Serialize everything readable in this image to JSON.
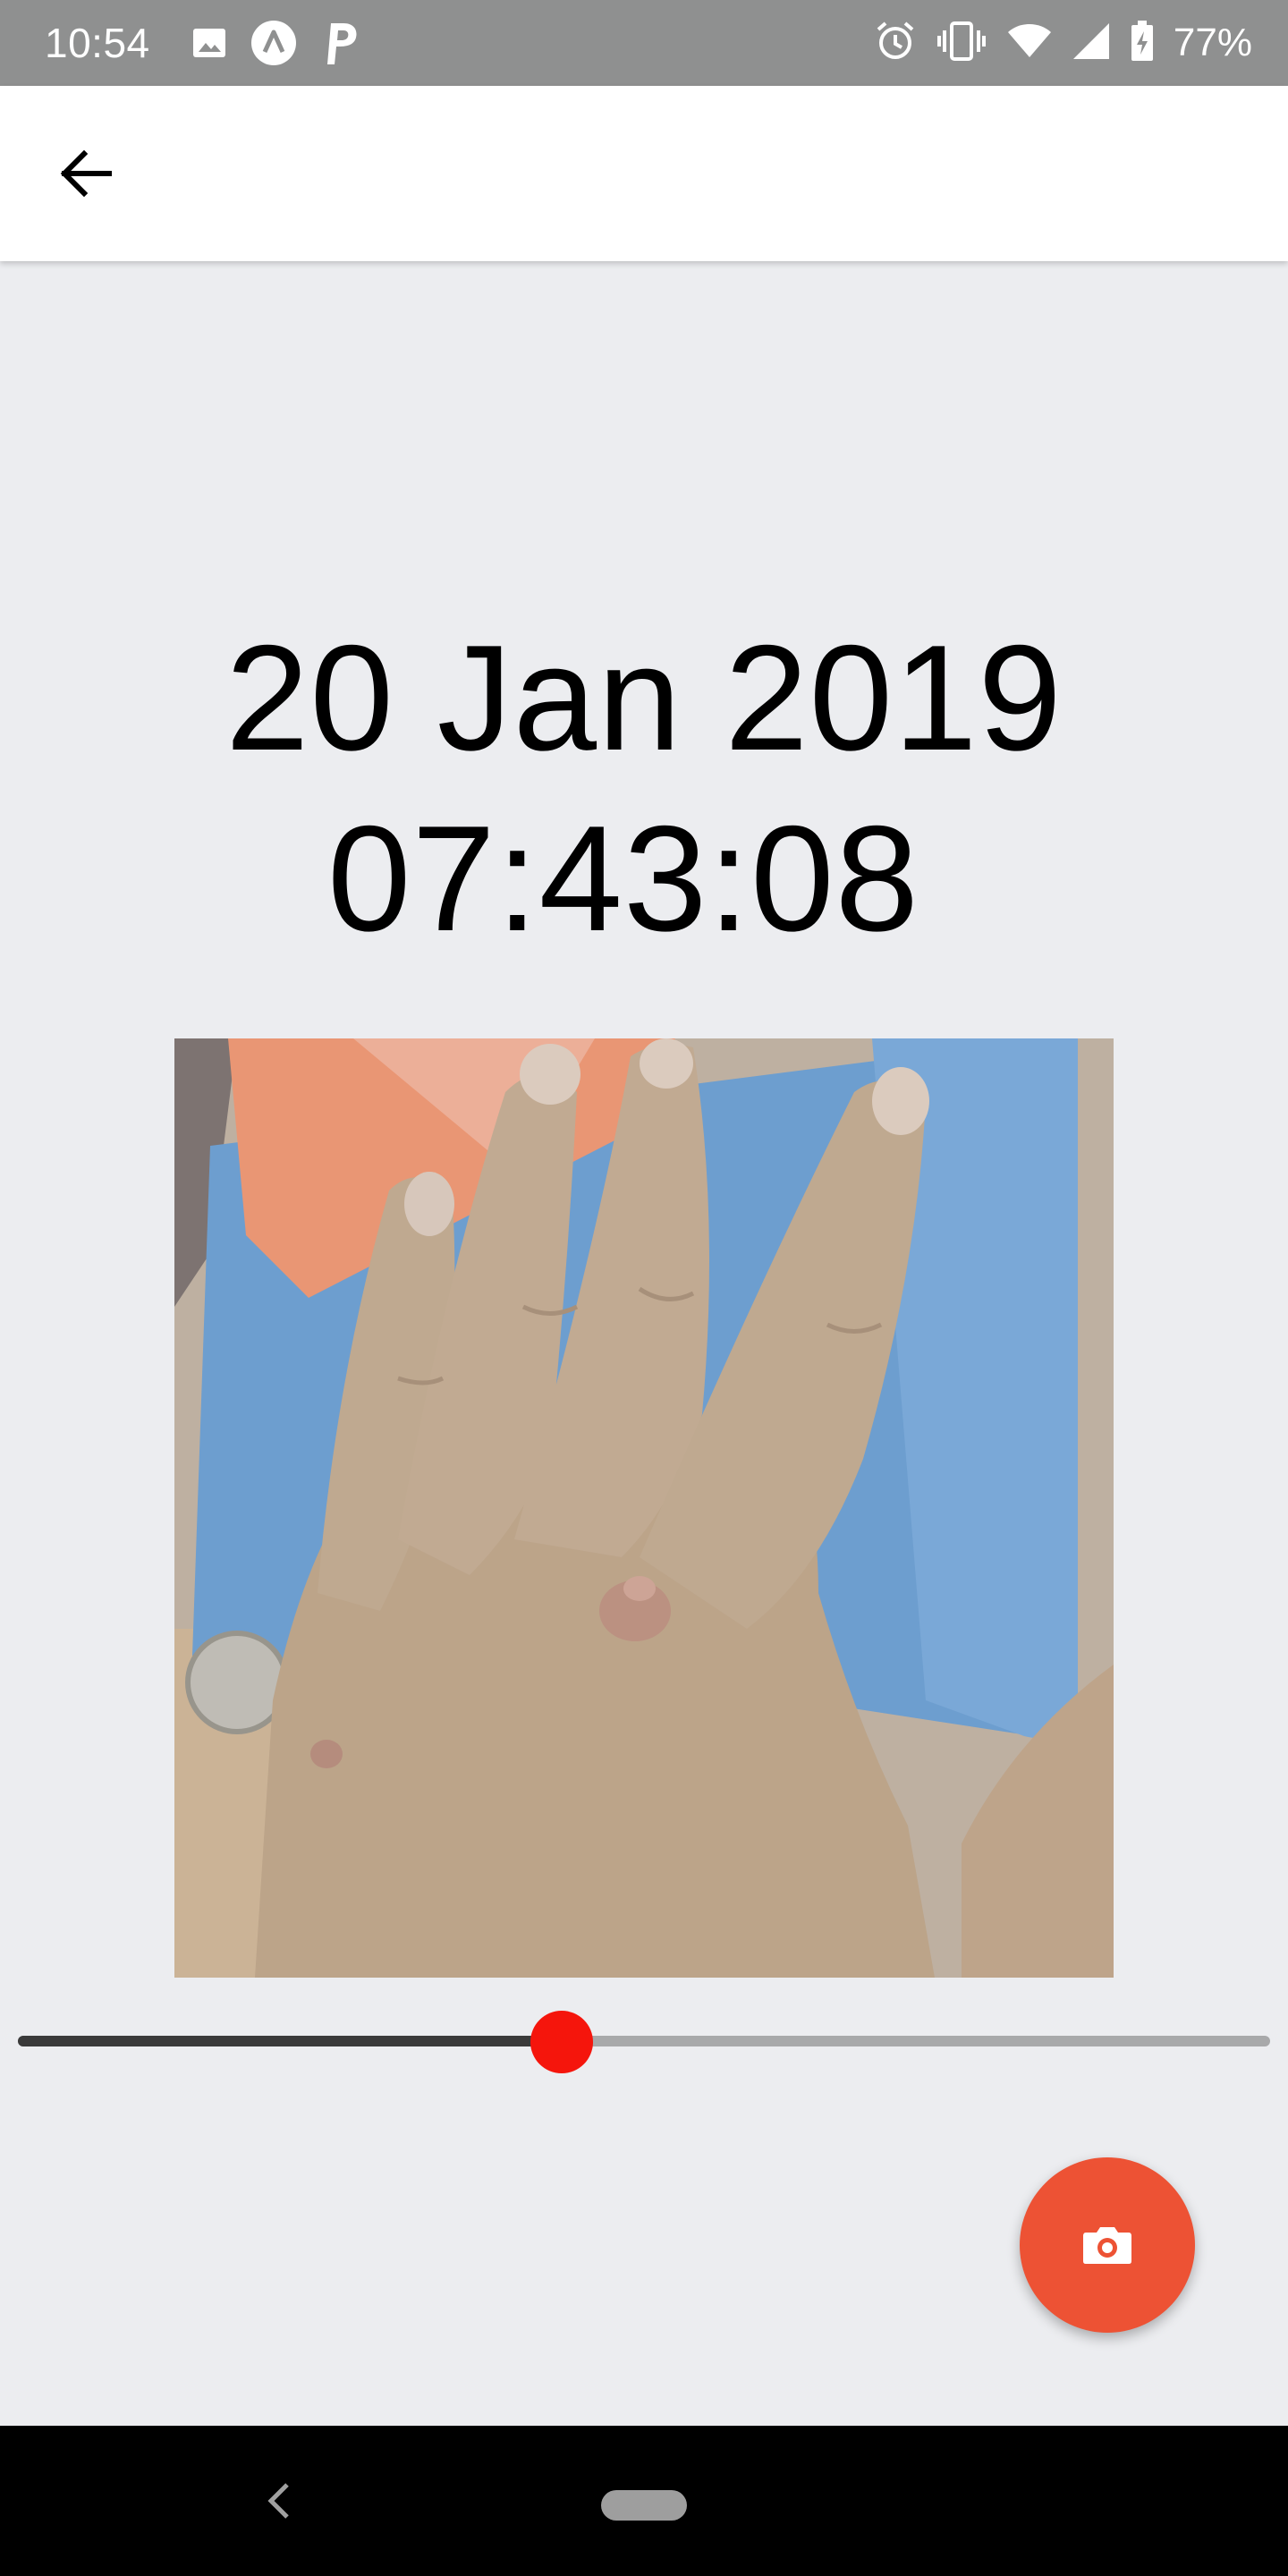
{
  "status_bar": {
    "time": "10:54",
    "battery": "77%",
    "icons_left": [
      "image-icon",
      "app-a-icon",
      "parking-p-icon"
    ],
    "icons_right": [
      "alarm-icon",
      "vibrate-icon",
      "wifi-icon",
      "signal-icon",
      "battery-charging-icon"
    ]
  },
  "app_bar": {
    "back_icon": "arrow-back-icon"
  },
  "capture": {
    "date": "20 Jan 2019",
    "time": "07:43:08"
  },
  "photo": {
    "subject": "hand-photo"
  },
  "slider": {
    "position": 0.434
  },
  "fab": {
    "icon": "camera-icon",
    "color": "#ED5234"
  },
  "colors": {
    "status_bar": "#8F9090",
    "background": "#ECEDF0",
    "slider_thumb": "#F5150C",
    "slider_active": "#3A3A3A",
    "slider_inactive": "#A8A9AA"
  }
}
